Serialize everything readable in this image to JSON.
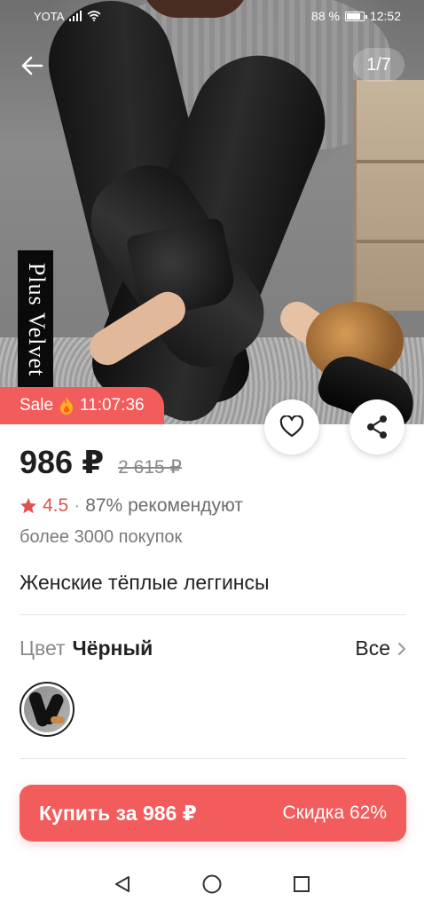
{
  "status_bar": {
    "carrier": "YOTA",
    "battery": "88 %",
    "time": "12:52",
    "icons": [
      "signal-icon",
      "wifi-icon",
      "battery-icon"
    ]
  },
  "gallery": {
    "counter": "1/7",
    "image_label": "Plus Velvet",
    "sale_label": "Sale",
    "sale_timer": "11:07:36"
  },
  "product": {
    "price": "986 ₽",
    "old_price": "2 615 ₽",
    "rating": "4.5",
    "separator": "·",
    "recommend": "87% рекомендуют",
    "purchases": "более 3000 покупок",
    "title": "Женские тёплые леггинсы"
  },
  "color": {
    "label": "Цвет",
    "value": "Чёрный",
    "see_all": "Все"
  },
  "buy": {
    "label": "Купить за 986 ₽",
    "discount": "Скидка 62%"
  },
  "colors": {
    "accent": "#f35c5c",
    "star": "#e0524f"
  }
}
